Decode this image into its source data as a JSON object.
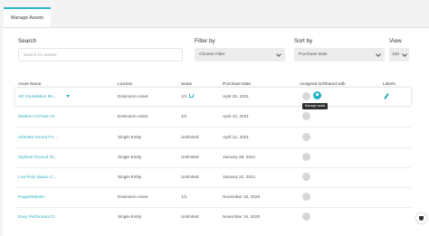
{
  "tabs": {
    "manage_assets": "Manage Assets"
  },
  "filters": {
    "search_label": "Search",
    "search_placeholder": "search for assets",
    "filter_label": "Filter by",
    "filter_value": "Choose Filter",
    "sort_label": "Sort by",
    "sort_value": "Purchase Date",
    "view_label": "View",
    "view_value": "100"
  },
  "table": {
    "headers": [
      "Asset Name",
      "License",
      "Seats",
      "Purchase Date",
      "Assigned to/Shared with",
      "Labels"
    ],
    "rows": [
      {
        "name": "AR Foundation Re...",
        "license": "Extension Asset",
        "seats": "1/1",
        "date": "April 15, 2021"
      },
      {
        "name": "Modern UI Pack V4",
        "license": "Extension Asset",
        "seats": "1/1",
        "date": "April 12, 2021"
      },
      {
        "name": "Ultimate Sound FX ...",
        "license": "Single-Entity",
        "seats": "Unlimited",
        "date": "April 12, 2021"
      },
      {
        "name": "Stylized Ground Te...",
        "license": "Single-Entity",
        "seats": "Unlimited",
        "date": "January 28, 2021"
      },
      {
        "name": "Low Poly Space C...",
        "license": "Single-Entity",
        "seats": "Unlimited",
        "date": "January 22, 2021"
      },
      {
        "name": "PuppetMaster",
        "license": "Extension Asset",
        "seats": "1/1",
        "date": "November 18, 2020"
      },
      {
        "name": "Easy Performant O...",
        "license": "Single-Entity",
        "seats": "Unlimited",
        "date": "November 16, 2020"
      }
    ]
  },
  "tooltip": "Manage seats",
  "icons": [
    "dropdown-caret-icon",
    "cart-icon",
    "manage-seats-icon",
    "pin-icon",
    "avatar-icon",
    "shield-icon"
  ],
  "colors": {
    "accent": "#2ab0c2",
    "tooltip_bg": "#2d2d2d"
  }
}
